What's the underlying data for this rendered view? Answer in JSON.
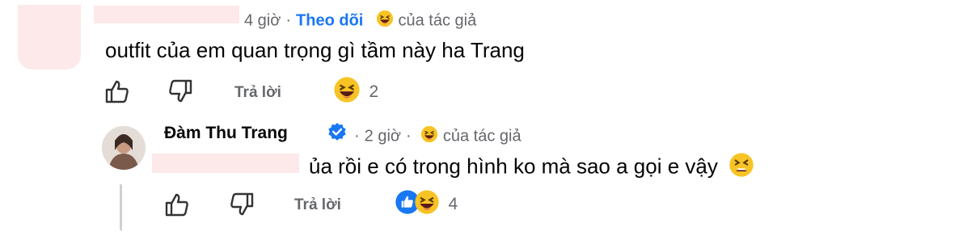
{
  "comment1": {
    "time": "4 giờ",
    "follow": "Theo dõi",
    "reaction_icon": "grinning-squinting-face",
    "author_note": "của tác giả",
    "text": "outfit của em quan trọng gì tầm này ha Trang",
    "actions": {
      "like_icon": "thumbs-up-icon",
      "dislike_icon": "thumbs-down-icon",
      "reply": "Trả lời"
    },
    "reactions": {
      "icons": [
        "grinning-squinting-face"
      ],
      "count": "2"
    }
  },
  "reply": {
    "author": "Đàm Thu Trang",
    "verified_icon": "verified-badge-icon",
    "time": "2 giờ",
    "reaction_icon": "grinning-squinting-face",
    "author_note": "của tác giả",
    "text": "ủa rồi e có trong hình ko mà sao a gọi e vậy",
    "trailing_emoji": "tired-face",
    "actions": {
      "like_icon": "thumbs-up-icon",
      "dislike_icon": "thumbs-down-icon",
      "reply": "Trả lời"
    },
    "reactions": {
      "icons": [
        "like",
        "grinning-squinting-face"
      ],
      "count": "4"
    }
  },
  "colors": {
    "link": "#1877f2",
    "muted": "#65676b",
    "redaction": "#fde9e9",
    "like_blue": "#1877f2",
    "emoji_yellow": "#f7c325"
  }
}
